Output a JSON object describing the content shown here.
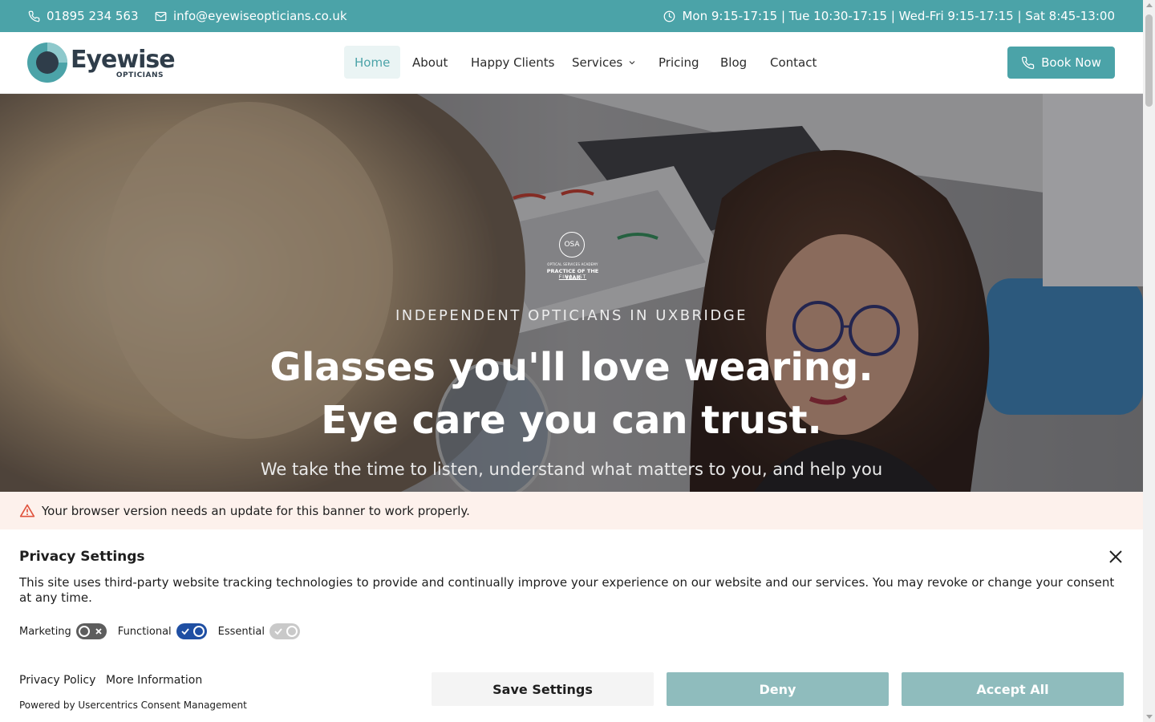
{
  "topbar": {
    "phone": "01895 234 563",
    "email": "info@eyewiseopticians.co.uk",
    "hours": "Mon 9:15-17:15 | Tue 10:30-17:15 | Wed-Fri 9:15-17:15 | Sat 8:45-13:00",
    "icons": [
      "phone-icon",
      "mail-icon",
      "clock-icon"
    ]
  },
  "logo": {
    "word": "Eyewise",
    "sub": "OPTICIANS"
  },
  "nav": {
    "items": [
      "Home",
      "About",
      "Happy Clients",
      "Services",
      "Pricing",
      "Blog",
      "Contact"
    ],
    "active": "Home",
    "book_label": "Book Now"
  },
  "hero": {
    "award": {
      "badge": "OSA",
      "line1": "OPTICAL SERVICES ACADEMY",
      "line2": "PRACTICE OF THE YEAR",
      "line3": "FINALIST"
    },
    "eyebrow": "INDEPENDENT OPTICIANS IN UXBRIDGE",
    "headline_1": "Glasses you'll love wearing.",
    "headline_2": "Eye care you can trust.",
    "subtext": "We take the time to listen, understand what matters to you, and help you"
  },
  "warning": {
    "text": "Your browser version needs an update for this banner to work properly."
  },
  "consent": {
    "title": "Privacy Settings",
    "description": "This site uses third-party website tracking technologies to provide and continually improve your experience on our website and our services. You may revoke or change your consent at any time.",
    "toggles": [
      {
        "label": "Marketing",
        "state": "off"
      },
      {
        "label": "Functional",
        "state": "on"
      },
      {
        "label": "Essential",
        "state": "disabled-on"
      }
    ],
    "links": {
      "privacy": "Privacy Policy",
      "more": "More Information"
    },
    "powered": "Powered by Usercentrics Consent Management",
    "buttons": {
      "save": "Save Settings",
      "deny": "Deny",
      "accept": "Accept All"
    }
  },
  "colors": {
    "brand_teal": "#4ba3a8",
    "nav_active_bg": "#eaf4f4",
    "warning_bg": "#fdf1ec",
    "warning_icon": "#e0533d",
    "toggle_on": "#1f4fa3",
    "toggle_off": "#5d5d5d",
    "consent_btn": "#8fbcbd",
    "logo_dark": "#2f3d4a"
  }
}
